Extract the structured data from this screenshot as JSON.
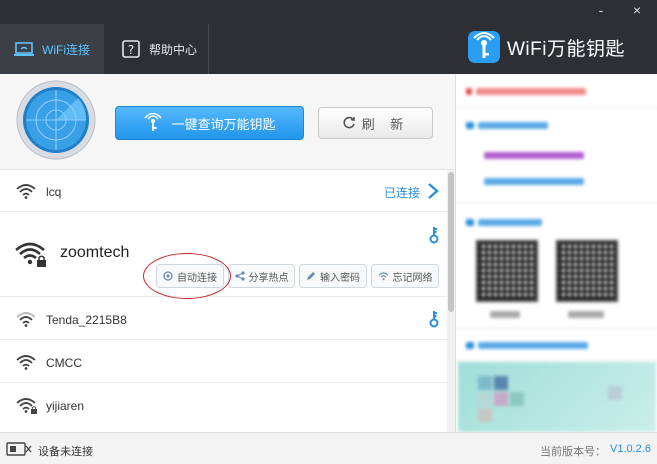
{
  "app": {
    "title": "WiFi万能钥匙",
    "tabs": [
      {
        "label": "WiFi连接",
        "active": true
      },
      {
        "label": "帮助中心",
        "active": false
      }
    ],
    "window_controls": {
      "minimize": "-",
      "close": "×"
    }
  },
  "toolbar": {
    "query_button": "一键查询万能钥匙",
    "refresh_button": "刷 新"
  },
  "networks": [
    {
      "ssid": "lcq",
      "status": "已连接",
      "icon": "wifi-icon"
    },
    {
      "ssid": "zoomtech",
      "icon": "wifi-lock-icon",
      "has_key": true,
      "actions": [
        "自动连接",
        "分享热点",
        "输入密码",
        "忘记网络"
      ]
    },
    {
      "ssid": "Tenda_2215B8",
      "icon": "wifi-icon",
      "has_key": true
    },
    {
      "ssid": "CMCC",
      "icon": "wifi-icon"
    },
    {
      "ssid": "yijiaren",
      "icon": "wifi-lock-icon"
    }
  ],
  "status_bar": {
    "connection_status": "设备未连接",
    "version_label": "当前版本号：",
    "version": "V1.0.2.6"
  },
  "colors": {
    "accent": "#2b8fd9",
    "titlebar": "#2c2f34",
    "annotation": "#c8262b"
  }
}
